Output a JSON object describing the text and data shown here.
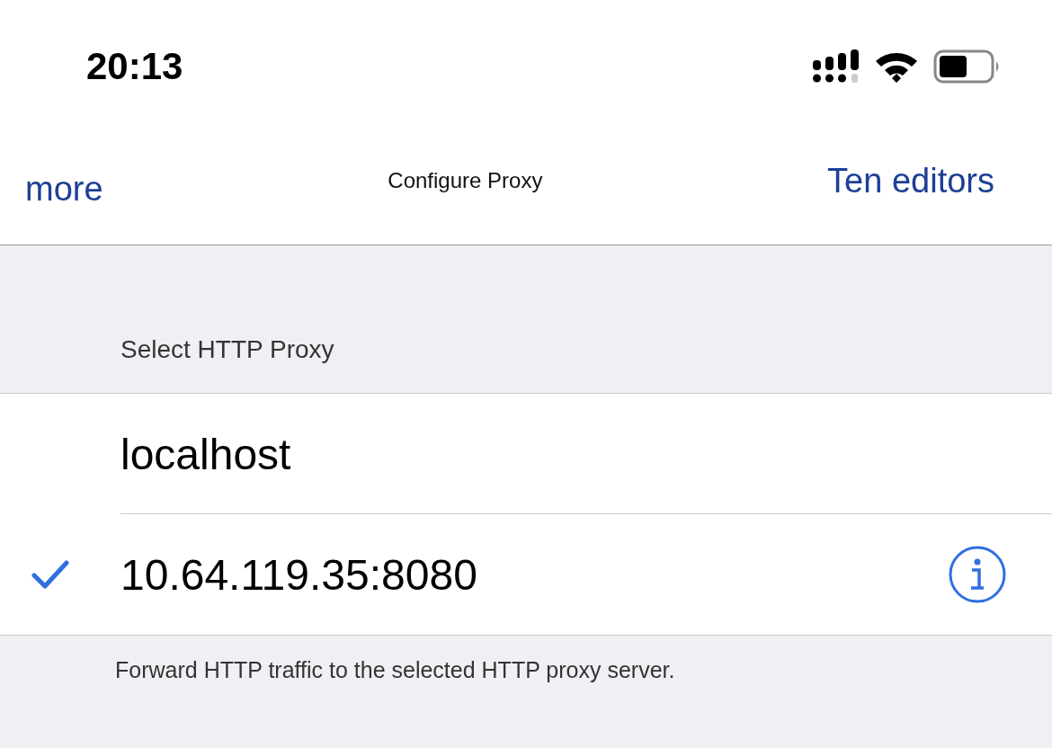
{
  "status_bar": {
    "time": "20:13"
  },
  "nav": {
    "back": "more",
    "title": "Configure Proxy",
    "action": "Ten editors"
  },
  "section": {
    "header": "Select HTTP Proxy",
    "items": [
      {
        "label": "localhost",
        "selected": false,
        "info": false
      },
      {
        "label": "10.64.119.35:8080",
        "selected": true,
        "info": true
      }
    ],
    "footer": "Forward HTTP traffic to the selected HTTP proxy server."
  }
}
